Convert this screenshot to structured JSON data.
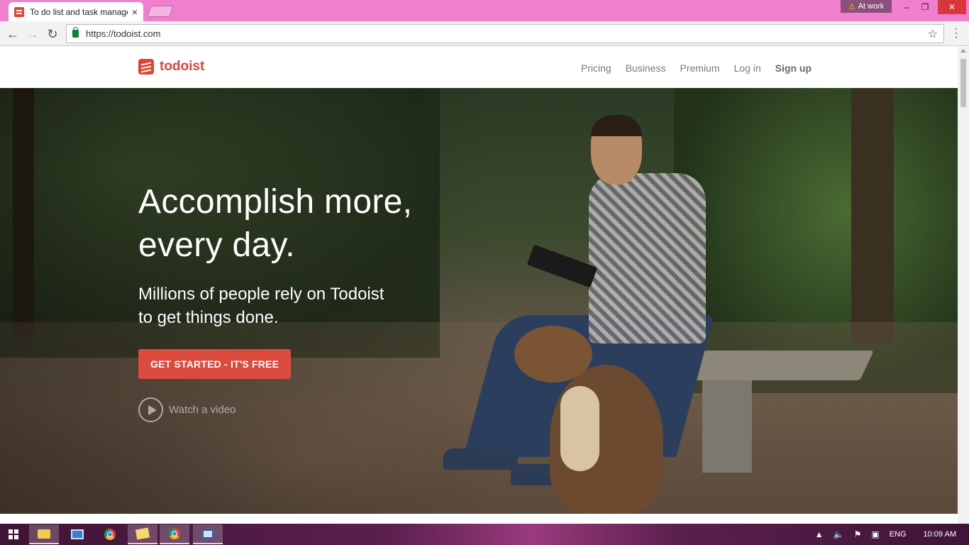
{
  "browser": {
    "tab_title": "To do list and task manager",
    "tab_close": "×",
    "profile_label": "At work",
    "url": "https://todoist.com",
    "window_controls": {
      "minimize": "–",
      "maximize": "❐",
      "close": "✕"
    },
    "nav": {
      "back": "←",
      "forward": "→",
      "reload": "↻"
    },
    "star": "☆"
  },
  "site": {
    "logo_text": "todoist",
    "nav": {
      "pricing": "Pricing",
      "business": "Business",
      "premium": "Premium",
      "login": "Log in",
      "signup": "Sign up"
    },
    "hero": {
      "headline_line1": "Accomplish more,",
      "headline_line2": "every day.",
      "subhead_line1": "Millions of people rely on Todoist",
      "subhead_line2": "to get things done.",
      "cta": "GET STARTED - IT'S FREE",
      "watch_video": "Watch a video"
    },
    "colors": {
      "brand": "#e44332",
      "cta": "#db4c3f"
    }
  },
  "taskbar": {
    "language": "ENG",
    "time": "10:09 AM",
    "apps": [
      "file-explorer",
      "remote-desktop",
      "chrome",
      "sticky-notes",
      "chrome-active",
      "window-app"
    ]
  }
}
